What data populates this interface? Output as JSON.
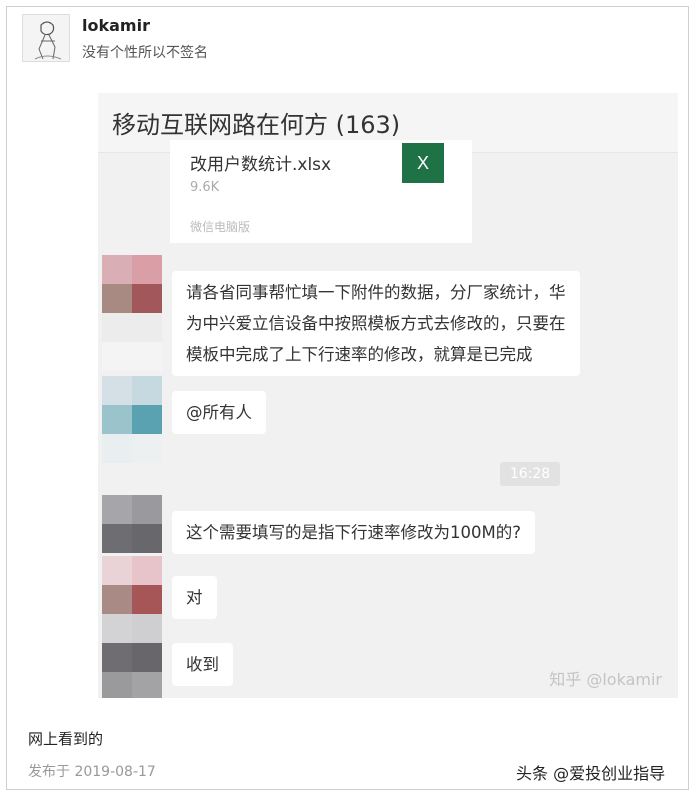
{
  "post": {
    "username": "lokamir",
    "signature": "没有个性所以不签名",
    "caption": "网上看到的",
    "publish_date": "发布于 2019-08-17",
    "brand_mark": "头条 @爱投创业指导"
  },
  "chat": {
    "title": "移动互联网路在何方 (163)",
    "file": {
      "name": "改用户数统计.xlsx",
      "size": "9.6K",
      "source": "微信电脑版",
      "icon_letter": "X",
      "icon_color": "#1f7146"
    },
    "messages": [
      {
        "lines": [
          "请各省同事帮忙填一下附件的数据，分厂家统计，华",
          "为中兴爱立信设备中按照模板方式去修改的，只要在",
          "模板中完成了上下行速率的修改，就算是已完成"
        ]
      },
      {
        "lines": [
          "@所有人"
        ]
      },
      {
        "lines": [
          "这个需要填写的是指下行速率修改为100M的?"
        ]
      },
      {
        "lines": [
          "对"
        ]
      },
      {
        "lines": [
          "收到"
        ]
      }
    ],
    "timestamp": "16:28",
    "watermark": "知乎 @lokamir"
  },
  "colors": {
    "chat_background": "#f1f1f1",
    "bubble": "#ffffff",
    "excel_green": "#1f7146"
  }
}
